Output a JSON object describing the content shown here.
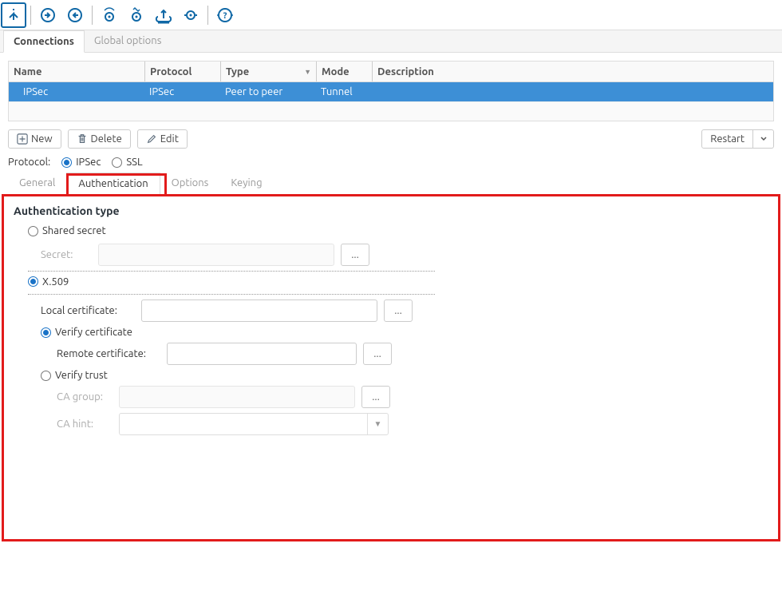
{
  "top_tabs": {
    "connections": "Connections",
    "global": "Global options"
  },
  "grid": {
    "cols": {
      "name": "Name",
      "protocol": "Protocol",
      "type": "Type",
      "mode": "Mode",
      "description": "Description"
    },
    "rows": [
      {
        "name": "IPSec",
        "protocol": "IPSec",
        "type": "Peer to peer",
        "mode": "Tunnel",
        "description": ""
      }
    ]
  },
  "buttons": {
    "new": "New",
    "delete": "Delete",
    "edit": "Edit",
    "restart": "Restart"
  },
  "protocol": {
    "label": "Protocol:",
    "ipsec": "IPSec",
    "ssl": "SSL",
    "selected": "ipsec"
  },
  "subtabs": {
    "general": "General",
    "authentication": "Authentication",
    "options": "Options",
    "keying": "Keying"
  },
  "auth": {
    "heading": "Authentication type",
    "shared_secret": "Shared secret",
    "secret_label": "Secret:",
    "x509": "X.509",
    "local_cert_label": "Local certificate:",
    "verify_cert": "Verify certificate",
    "remote_cert_label": "Remote certificate:",
    "verify_trust": "Verify trust",
    "ca_group_label": "CA group:",
    "ca_hint_label": "CA hint:",
    "browse": "..."
  }
}
